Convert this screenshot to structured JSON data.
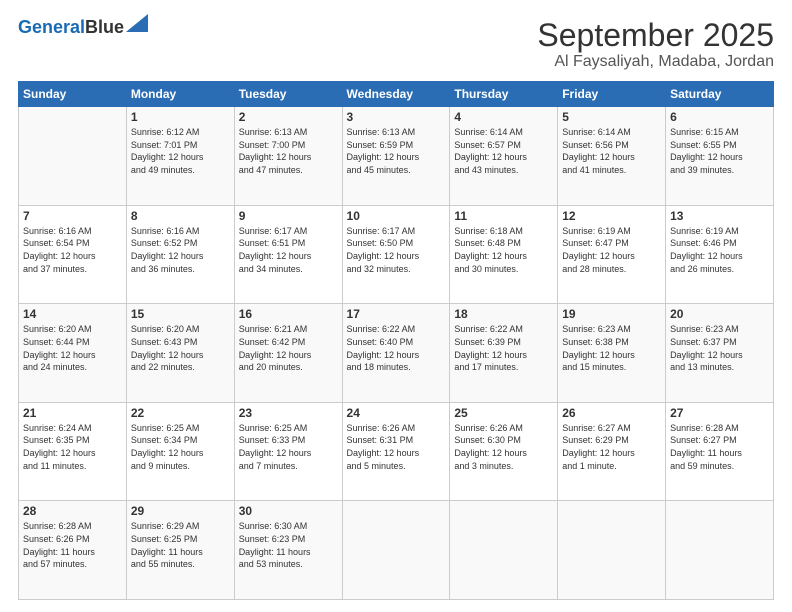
{
  "header": {
    "logo_line1": "General",
    "logo_line2": "Blue",
    "title": "September 2025",
    "subtitle": "Al Faysaliyah, Madaba, Jordan"
  },
  "weekdays": [
    "Sunday",
    "Monday",
    "Tuesday",
    "Wednesday",
    "Thursday",
    "Friday",
    "Saturday"
  ],
  "weeks": [
    [
      {
        "day": "",
        "info": ""
      },
      {
        "day": "1",
        "info": "Sunrise: 6:12 AM\nSunset: 7:01 PM\nDaylight: 12 hours\nand 49 minutes."
      },
      {
        "day": "2",
        "info": "Sunrise: 6:13 AM\nSunset: 7:00 PM\nDaylight: 12 hours\nand 47 minutes."
      },
      {
        "day": "3",
        "info": "Sunrise: 6:13 AM\nSunset: 6:59 PM\nDaylight: 12 hours\nand 45 minutes."
      },
      {
        "day": "4",
        "info": "Sunrise: 6:14 AM\nSunset: 6:57 PM\nDaylight: 12 hours\nand 43 minutes."
      },
      {
        "day": "5",
        "info": "Sunrise: 6:14 AM\nSunset: 6:56 PM\nDaylight: 12 hours\nand 41 minutes."
      },
      {
        "day": "6",
        "info": "Sunrise: 6:15 AM\nSunset: 6:55 PM\nDaylight: 12 hours\nand 39 minutes."
      }
    ],
    [
      {
        "day": "7",
        "info": "Sunrise: 6:16 AM\nSunset: 6:54 PM\nDaylight: 12 hours\nand 37 minutes."
      },
      {
        "day": "8",
        "info": "Sunrise: 6:16 AM\nSunset: 6:52 PM\nDaylight: 12 hours\nand 36 minutes."
      },
      {
        "day": "9",
        "info": "Sunrise: 6:17 AM\nSunset: 6:51 PM\nDaylight: 12 hours\nand 34 minutes."
      },
      {
        "day": "10",
        "info": "Sunrise: 6:17 AM\nSunset: 6:50 PM\nDaylight: 12 hours\nand 32 minutes."
      },
      {
        "day": "11",
        "info": "Sunrise: 6:18 AM\nSunset: 6:48 PM\nDaylight: 12 hours\nand 30 minutes."
      },
      {
        "day": "12",
        "info": "Sunrise: 6:19 AM\nSunset: 6:47 PM\nDaylight: 12 hours\nand 28 minutes."
      },
      {
        "day": "13",
        "info": "Sunrise: 6:19 AM\nSunset: 6:46 PM\nDaylight: 12 hours\nand 26 minutes."
      }
    ],
    [
      {
        "day": "14",
        "info": "Sunrise: 6:20 AM\nSunset: 6:44 PM\nDaylight: 12 hours\nand 24 minutes."
      },
      {
        "day": "15",
        "info": "Sunrise: 6:20 AM\nSunset: 6:43 PM\nDaylight: 12 hours\nand 22 minutes."
      },
      {
        "day": "16",
        "info": "Sunrise: 6:21 AM\nSunset: 6:42 PM\nDaylight: 12 hours\nand 20 minutes."
      },
      {
        "day": "17",
        "info": "Sunrise: 6:22 AM\nSunset: 6:40 PM\nDaylight: 12 hours\nand 18 minutes."
      },
      {
        "day": "18",
        "info": "Sunrise: 6:22 AM\nSunset: 6:39 PM\nDaylight: 12 hours\nand 17 minutes."
      },
      {
        "day": "19",
        "info": "Sunrise: 6:23 AM\nSunset: 6:38 PM\nDaylight: 12 hours\nand 15 minutes."
      },
      {
        "day": "20",
        "info": "Sunrise: 6:23 AM\nSunset: 6:37 PM\nDaylight: 12 hours\nand 13 minutes."
      }
    ],
    [
      {
        "day": "21",
        "info": "Sunrise: 6:24 AM\nSunset: 6:35 PM\nDaylight: 12 hours\nand 11 minutes."
      },
      {
        "day": "22",
        "info": "Sunrise: 6:25 AM\nSunset: 6:34 PM\nDaylight: 12 hours\nand 9 minutes."
      },
      {
        "day": "23",
        "info": "Sunrise: 6:25 AM\nSunset: 6:33 PM\nDaylight: 12 hours\nand 7 minutes."
      },
      {
        "day": "24",
        "info": "Sunrise: 6:26 AM\nSunset: 6:31 PM\nDaylight: 12 hours\nand 5 minutes."
      },
      {
        "day": "25",
        "info": "Sunrise: 6:26 AM\nSunset: 6:30 PM\nDaylight: 12 hours\nand 3 minutes."
      },
      {
        "day": "26",
        "info": "Sunrise: 6:27 AM\nSunset: 6:29 PM\nDaylight: 12 hours\nand 1 minute."
      },
      {
        "day": "27",
        "info": "Sunrise: 6:28 AM\nSunset: 6:27 PM\nDaylight: 11 hours\nand 59 minutes."
      }
    ],
    [
      {
        "day": "28",
        "info": "Sunrise: 6:28 AM\nSunset: 6:26 PM\nDaylight: 11 hours\nand 57 minutes."
      },
      {
        "day": "29",
        "info": "Sunrise: 6:29 AM\nSunset: 6:25 PM\nDaylight: 11 hours\nand 55 minutes."
      },
      {
        "day": "30",
        "info": "Sunrise: 6:30 AM\nSunset: 6:23 PM\nDaylight: 11 hours\nand 53 minutes."
      },
      {
        "day": "",
        "info": ""
      },
      {
        "day": "",
        "info": ""
      },
      {
        "day": "",
        "info": ""
      },
      {
        "day": "",
        "info": ""
      }
    ]
  ]
}
